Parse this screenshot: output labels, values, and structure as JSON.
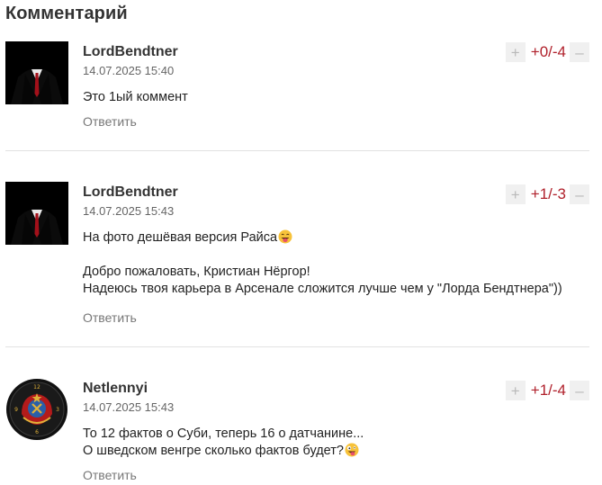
{
  "section": {
    "title": "Комментарий"
  },
  "comments": [
    {
      "author": "LordBendtner",
      "date": "14.07.2025 15:40",
      "avatar": "suit-avatar",
      "lines": [
        "Это 1ый коммент"
      ],
      "score": "+0/-4",
      "reply_label": "Ответить",
      "upvote_icon": "plus-icon",
      "downvote_icon": "minus-icon"
    },
    {
      "author": "LordBendtner",
      "date": "14.07.2025 15:43",
      "avatar": "suit-avatar",
      "lines": [
        "На фото дешёвая версия Райса",
        "",
        "Добро пожаловать, Кристиан Нёргор!",
        "Надеюсь твоя карьера в Арсенале сложится лучше чем у \"Лорда Бендтнера\"))"
      ],
      "emoji": "tongue-emoji",
      "score": "+1/-3",
      "reply_label": "Ответить",
      "upvote_icon": "plus-icon",
      "downvote_icon": "minus-icon"
    },
    {
      "author": "Netlennyi",
      "date": "14.07.2025 15:43",
      "avatar": "emblem-clock-avatar",
      "lines": [
        "То 12 фактов о Суби, теперь 16 о датчанине...",
        "О шведском венгре сколько фактов будет?"
      ],
      "emoji": "zany-emoji",
      "score": "+1/-4",
      "reply_label": "Ответить",
      "upvote_icon": "plus-icon",
      "downvote_icon": "minus-icon"
    }
  ],
  "colors": {
    "score": "#b0202b",
    "reply": "#777777",
    "divider": "#e2e2e2"
  }
}
